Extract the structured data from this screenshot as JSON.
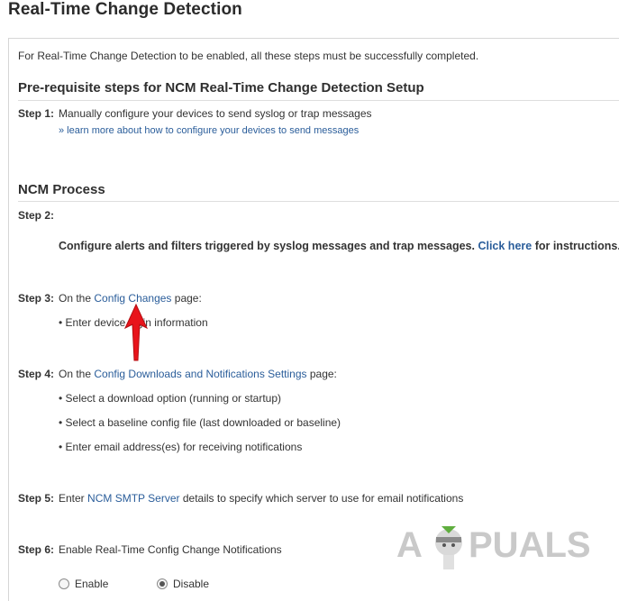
{
  "page": {
    "title": "Real-Time Change Detection"
  },
  "intro": "For Real-Time Change Detection to be enabled, all these steps must be successfully completed.",
  "prereq": {
    "heading": "Pre-requisite steps for NCM Real-Time Change Detection Setup",
    "step1_label": "Step 1:",
    "step1_text": "Manually configure your devices to send syslog or trap messages",
    "step1_link": "» learn more about how to configure your devices to send messages"
  },
  "process": {
    "heading": "NCM Process",
    "step2_label": "Step 2:",
    "step2_text": "Configure alerts and filters triggered by syslog messages and trap messages.",
    "step2_link": "Click here",
    "step2_after": "for instructions.",
    "step3_label": "Step 3:",
    "step3_prefix": "On the",
    "step3_link": "Config Changes",
    "step3_suffix": "page:",
    "step3_bullet": "• Enter device login information",
    "step4_label": "Step 4:",
    "step4_prefix": "On the",
    "step4_link": "Config Downloads and Notifications Settings",
    "step4_suffix": "page:",
    "step4_bullets": [
      "• Select a download option (running or startup)",
      "• Select a baseline config file (last downloaded or baseline)",
      "• Enter email address(es) for receiving notifications"
    ],
    "step5_label": "Step 5:",
    "step5_prefix": "Enter",
    "step5_link": "NCM SMTP Server",
    "step5_suffix": "details to specify which server to use for email notifications",
    "step6_label": "Step 6:",
    "step6_text": "Enable Real-Time Config Change Notifications",
    "radio_enable": "Enable",
    "radio_disable": "Disable",
    "selected": "Disable"
  },
  "watermark": "A PUALS",
  "colors": {
    "link": "#2a5d9a",
    "arrow": "#e8141b",
    "text": "#333333"
  }
}
